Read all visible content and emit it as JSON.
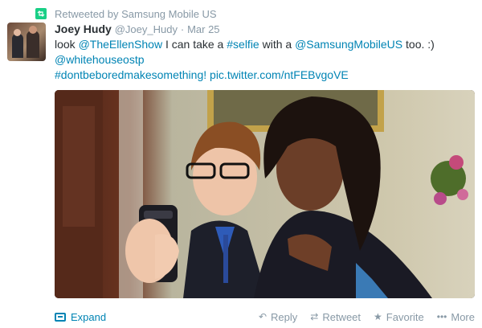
{
  "retweet": {
    "text": "Retweeted by Samsung Mobile US"
  },
  "tweet": {
    "fullname": "Joey Hudy",
    "username": "@Joey_Hudy",
    "separator": "·",
    "date": "Mar 25",
    "line1": {
      "t1": "look ",
      "mention1": "@TheEllenShow",
      "t2": " I can take a ",
      "hashtag1": "#selfie",
      "t3": " with a ",
      "mention2": "@SamsungMobileUS",
      "t4": " too. :)"
    },
    "line2": {
      "mention3": "@whitehouseostp"
    },
    "line3": {
      "hashtag2": "#dontbeboredmakesomething!",
      "space": " ",
      "pic_link": "pic.twitter.com/ntFEBvgoVE"
    }
  },
  "footer": {
    "expand": "Expand",
    "reply": "Reply",
    "retweet": "Retweet",
    "favorite": "Favorite",
    "more": "More"
  },
  "colors": {
    "link": "#0084b4",
    "meta": "#8899a6",
    "text": "#292f33",
    "retweet_green": "#19cf86"
  },
  "icons": [
    "retweet-icon",
    "expand-icon",
    "reply-icon",
    "retweet-action-icon",
    "favorite-star-icon",
    "more-dots-icon"
  ]
}
